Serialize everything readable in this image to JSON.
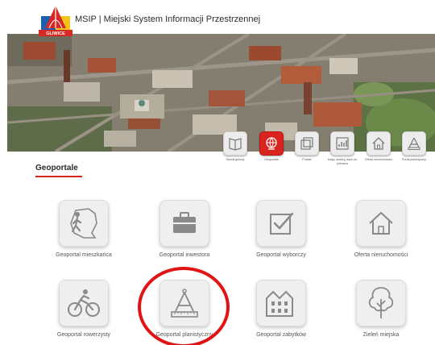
{
  "header": {
    "title": "MSIP | Miejski System Informacji Przestrzennej",
    "logo_caption": "GLIWICE"
  },
  "hero_nav": [
    {
      "label": "Serwis główny",
      "icon": "book-icon"
    },
    {
      "label": "Geoportale",
      "icon": "globe-icon",
      "active": true
    },
    {
      "label": "Portale",
      "icon": "windows-icon"
    },
    {
      "label": "Mapy, analizy, dane do pobrania",
      "icon": "chart-icon"
    },
    {
      "label": "Oferta nieruchomości",
      "icon": "house-icon"
    },
    {
      "label": "Portal planistyczny",
      "icon": "compass-icon"
    }
  ],
  "section": {
    "title": "Geoportale"
  },
  "cards": [
    {
      "label": "Geoportal mieszkańca",
      "icon": "walker-map-icon"
    },
    {
      "label": "Geoportal inwestora",
      "icon": "briefcase-icon"
    },
    {
      "label": "Geoportal wyborczy",
      "icon": "ballot-check-icon"
    },
    {
      "label": "Oferta nieruchomości",
      "icon": "house-icon"
    },
    {
      "label": "Geoportal rowerzysty",
      "icon": "bicycle-icon"
    },
    {
      "label": "Geoportal planistyczny",
      "icon": "compass-ruler-icon"
    },
    {
      "label": "Geoportal zabytków",
      "icon": "historic-building-icon"
    },
    {
      "label": "Zieleń miejska",
      "icon": "tree-icon"
    }
  ],
  "colors": {
    "accent": "#d9231f",
    "highlight_circle": "#e01414"
  }
}
